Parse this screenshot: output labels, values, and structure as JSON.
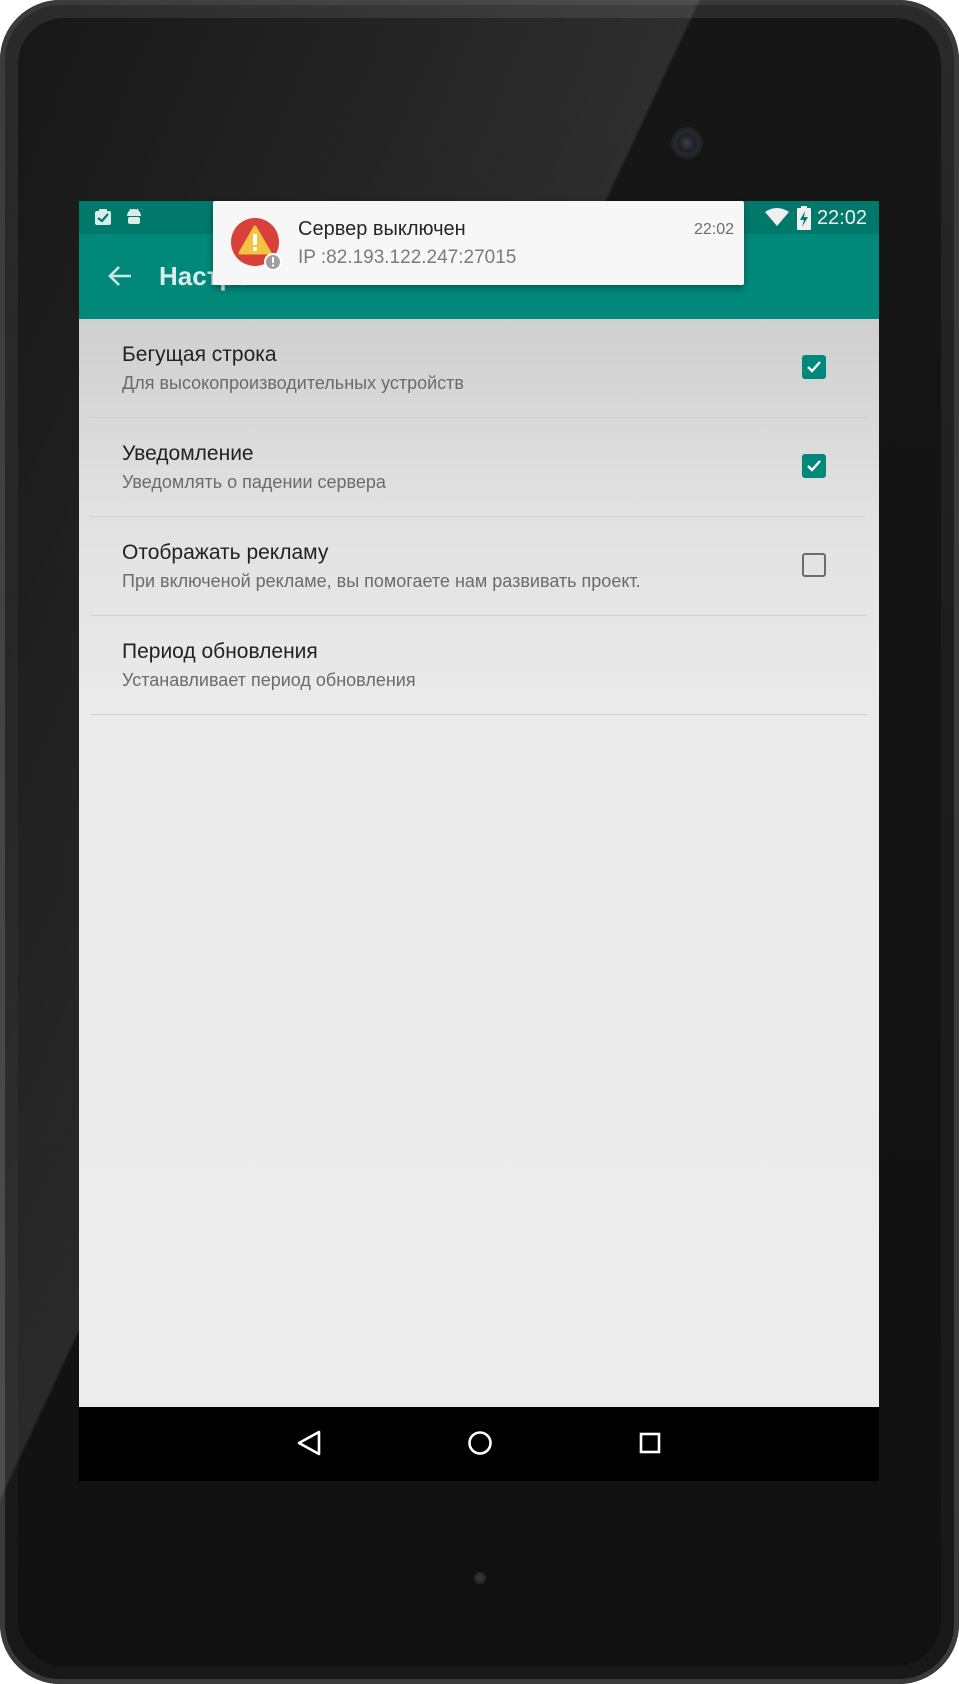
{
  "status_bar": {
    "time": "22:02",
    "left_icons": [
      "clipboard-check-icon",
      "android-debug-icon"
    ],
    "right_icons": [
      "wifi-icon",
      "battery-charging-icon"
    ]
  },
  "app_bar": {
    "title": "Настройки",
    "back_icon": "arrow-back-icon"
  },
  "notification": {
    "title": "Сервер выключен",
    "text": "IP :82.193.122.247:27015",
    "time": "22:02",
    "icon": "warning-icon"
  },
  "preferences": [
    {
      "title": "Бегущая строка",
      "summary": "Для высокопроизводительных устройств",
      "checked": true
    },
    {
      "title": "Уведомление",
      "summary": "Уведомлять о падении сервера",
      "checked": true
    },
    {
      "title": "Отображать рекламу",
      "summary": "При включеной рекламе, вы помогаете нам развивать проект.",
      "checked": false
    },
    {
      "title": "Период обновления",
      "summary": "Устанавливает период обновления",
      "checked": null
    }
  ],
  "nav_bar": {
    "buttons": [
      "back-triangle-icon",
      "home-circle-icon",
      "recents-square-icon"
    ]
  },
  "colors": {
    "primary": "#00897b",
    "primary_dark": "#00796b",
    "background": "#ececec",
    "warning_red": "#d9403a",
    "warning_yellow": "#f5c342"
  }
}
